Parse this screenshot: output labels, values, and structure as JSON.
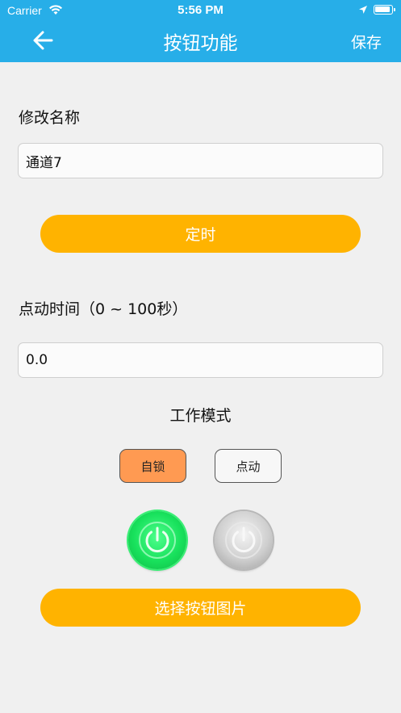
{
  "status_bar": {
    "carrier": "Carrier",
    "time": "5:56 PM"
  },
  "nav": {
    "title": "按钮功能",
    "save_label": "保存",
    "back_icon": "arrow-left-icon"
  },
  "rename": {
    "label": "修改名称",
    "value": "通道7"
  },
  "timer_button": "定时",
  "jog_time": {
    "label": "点动时间（0 ~ 100秒）",
    "value": "0.0"
  },
  "work_mode": {
    "title": "工作模式",
    "options": [
      "自锁",
      "点动"
    ],
    "selected": "自锁"
  },
  "power_icons": [
    "power-icon-green",
    "power-icon-gray"
  ],
  "select_image_button": "选择按钮图片",
  "colors": {
    "header": "#27aee8",
    "accent": "#ffb300",
    "selected_mode": "#ff9a52",
    "background": "#f0f0f0"
  }
}
